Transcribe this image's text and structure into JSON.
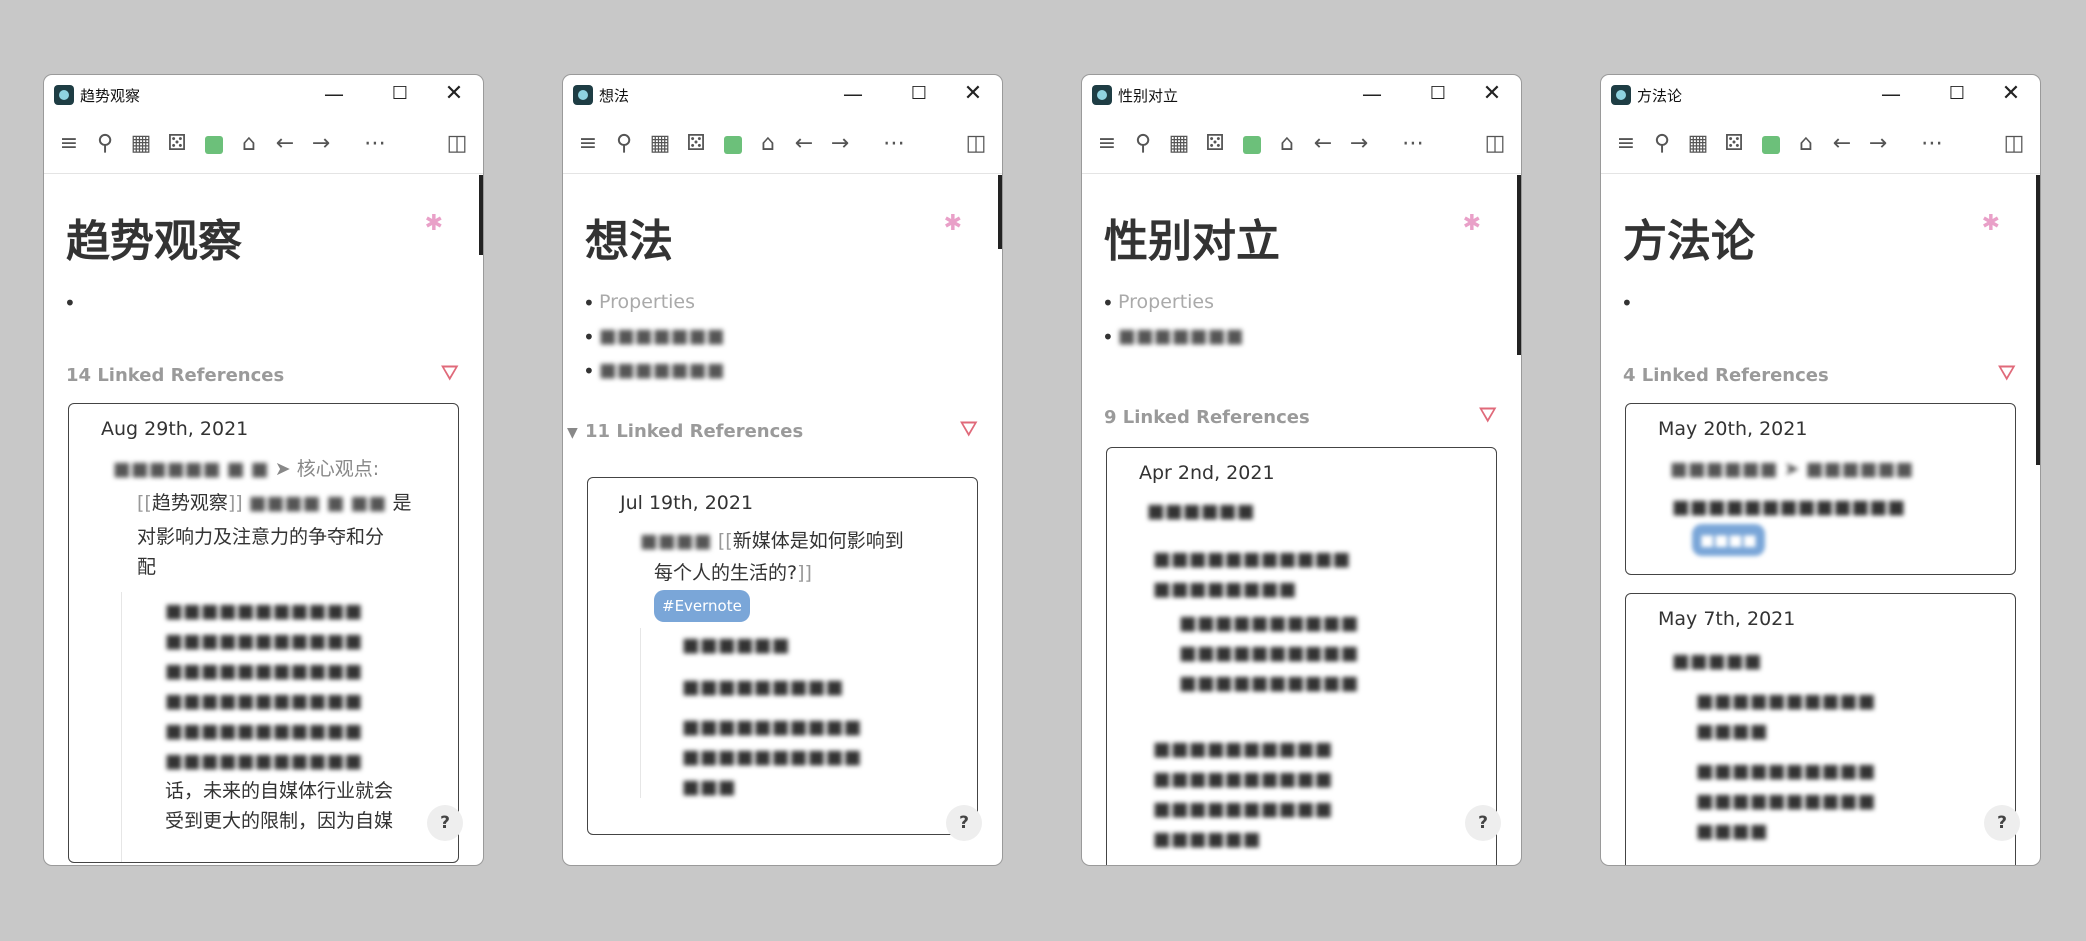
{
  "toolbar_icons": [
    "menu-icon",
    "search-icon",
    "calendar-icon",
    "dice-icon",
    "green-square-icon",
    "home-icon",
    "arrow-left-icon",
    "arrow-right-icon",
    "more-icon",
    "sidebar-toggle-icon"
  ],
  "window_controls": {
    "minimize": "—",
    "maximize": "☐",
    "close": "✕"
  },
  "help": "?",
  "windows": [
    {
      "title": "趋势观察",
      "page_title": "趋势观察",
      "refs": "14 Linked References",
      "card_date": "Aug 29th, 2021",
      "breadcrumb": "核心观点:",
      "link": "趋势观察",
      "text1": "是",
      "text2": "对影响力及注意力的争夺和分",
      "text3": "配",
      "body1": "话，未来的自媒体行业就会",
      "body2": "受到更大的限制，因为自媒"
    },
    {
      "title": "想法",
      "page_title": "想法",
      "properties": "Properties",
      "refs": "11 Linked References",
      "card_date": "Jul 19th, 2021",
      "link_a": "新媒体是如何影响到",
      "link_b": "每个人的生活的?",
      "tag": "#Evernote"
    },
    {
      "title": "性别对立",
      "page_title": "性别对立",
      "properties": "Properties",
      "refs": "9 Linked References",
      "card_date": "Apr 2nd, 2021"
    },
    {
      "title": "方法论",
      "page_title": "方法论",
      "refs": "4 Linked References",
      "card_date_1": "May 20th, 2021",
      "card_date_2": "May 7th, 2021"
    }
  ]
}
